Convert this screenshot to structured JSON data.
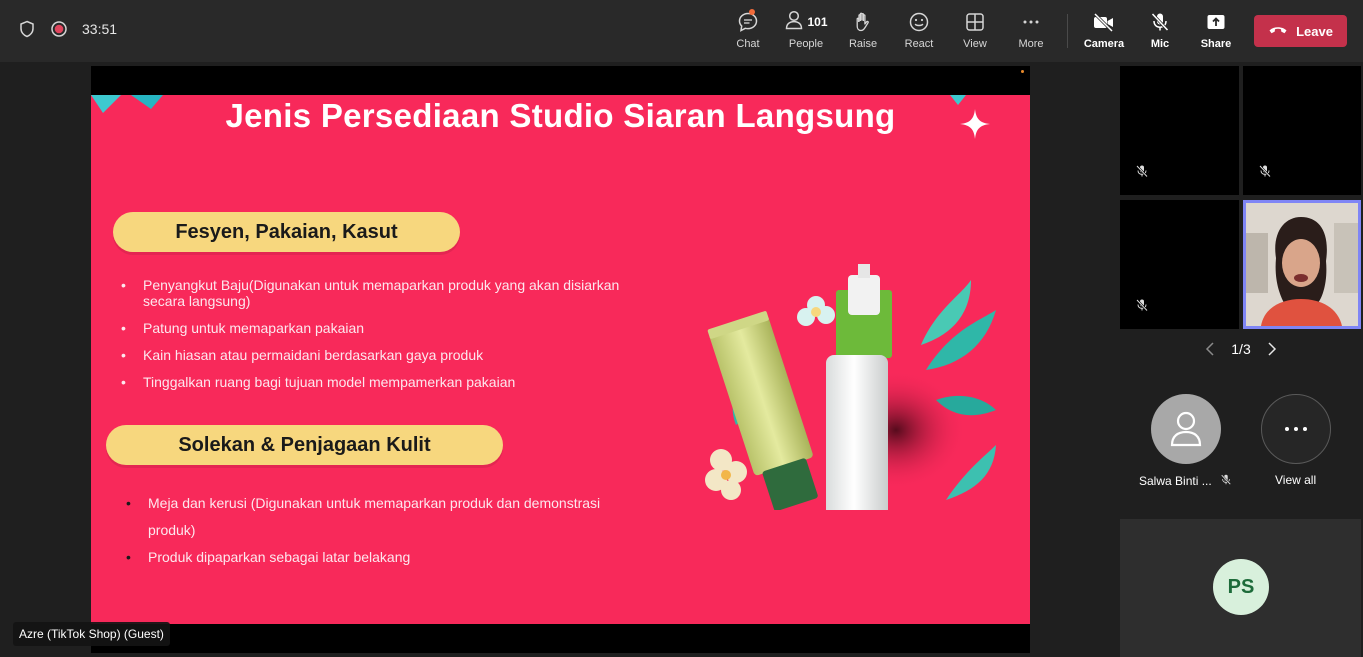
{
  "topbar": {
    "timer": "33:51",
    "buttons": {
      "chat": "Chat",
      "people": "People",
      "people_count": "101",
      "raise": "Raise",
      "react": "React",
      "view": "View",
      "more": "More",
      "camera": "Camera",
      "mic": "Mic",
      "share": "Share"
    },
    "leave": "Leave",
    "colors": {
      "leave_bg": "#c4314b",
      "notification_dot": "#f26b3a"
    }
  },
  "shared_screen": {
    "presenter": "Azre (TikTok Shop) (Guest)",
    "slide": {
      "title": "Jenis Persediaan Studio Siaran Langsung",
      "sections": [
        {
          "heading": "Fesyen, Pakaian, Kasut",
          "items": [
            "Penyangkut Baju(Digunakan untuk memaparkan produk yang akan disiarkan secara langsung)",
            "Patung untuk memaparkan pakaian",
            "Kain hiasan atau permaidani berdasarkan gaya produk",
            "Tinggalkan ruang bagi tujuan model mempamerkan pakaian"
          ]
        },
        {
          "heading": "Solekan & Penjagaan Kulit",
          "items": [
            "Meja dan kerusi (Digunakan untuk memaparkan produk dan demonstrasi produk)",
            "Produk dipaparkan sebagai latar belakang"
          ]
        }
      ],
      "colors": {
        "background": "#f8295a",
        "pill": "#f7d77e"
      }
    }
  },
  "right_panel": {
    "pager": "1/3",
    "participants": [
      {
        "name": "Salwa Binti ...",
        "muted": true
      },
      {
        "name": "View all"
      }
    ],
    "ps_card": {
      "initials": "PS"
    }
  }
}
